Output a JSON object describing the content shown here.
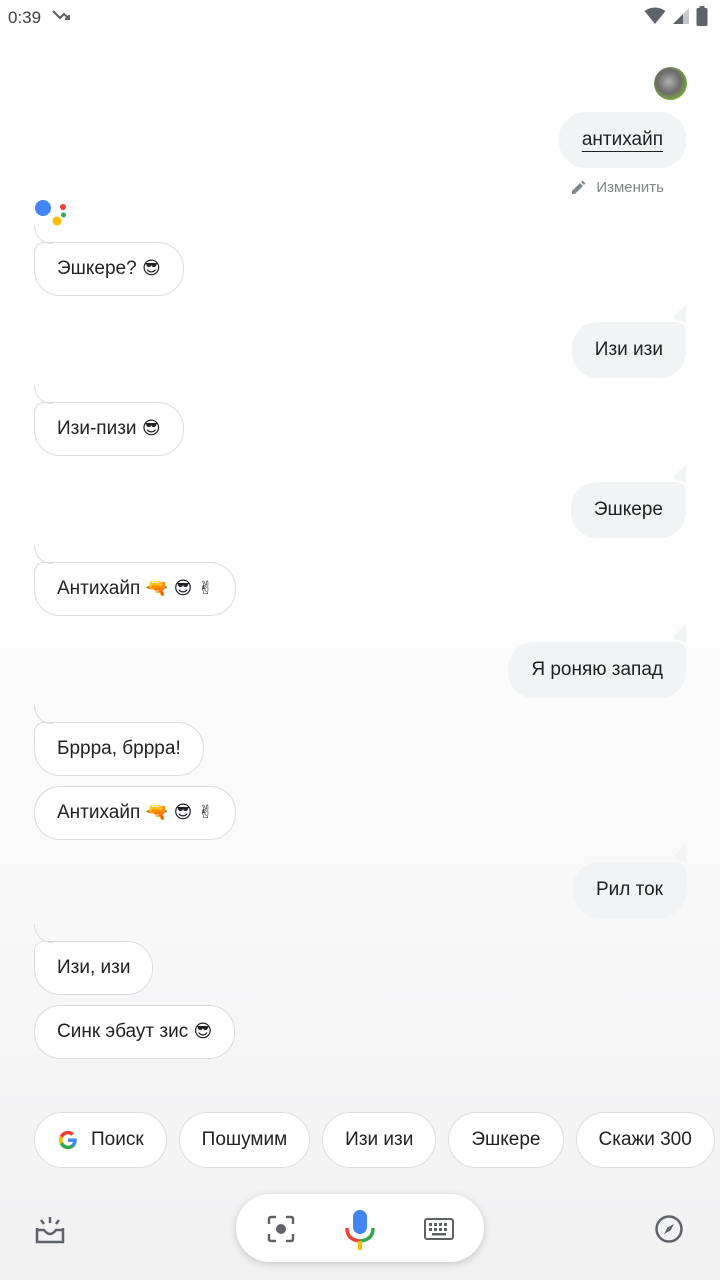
{
  "status": {
    "time": "0:39"
  },
  "conversation": {
    "user_query": "антихайп",
    "edit_label": "Изменить",
    "messages": [
      {
        "role": "assistant",
        "text": "Эшкере?",
        "emoji": "😎"
      },
      {
        "role": "user",
        "text": "Изи изи"
      },
      {
        "role": "assistant",
        "text": "Изи-пизи",
        "emoji": "😎"
      },
      {
        "role": "user",
        "text": "Эшкере"
      },
      {
        "role": "assistant",
        "text": "Антихайп",
        "emoji": "🔫 😎 ✌"
      },
      {
        "role": "user",
        "text": "Я роняю запад"
      },
      {
        "role": "assistant",
        "text": "Брррa, брррa!"
      },
      {
        "role": "assistant",
        "text": "Антихайп",
        "emoji": "🔫 😎 ✌"
      },
      {
        "role": "user",
        "text": "Рил ток"
      },
      {
        "role": "assistant",
        "text": "Изи, изи"
      },
      {
        "role": "assistant",
        "text": "Синк эбаут зис",
        "emoji": "😎"
      }
    ]
  },
  "suggestions": [
    "Поиск",
    "Пошумим",
    "Изи изи",
    "Эшкере",
    "Скажи 300"
  ],
  "icons": {
    "updates": "inbox-sparkle-icon",
    "lens": "lens-icon",
    "mic": "mic-icon",
    "keyboard": "keyboard-icon",
    "explore": "compass-icon"
  },
  "colors": {
    "blue": "#4285F4",
    "red": "#EA4335",
    "yellow": "#FBBC05",
    "green": "#34A853"
  }
}
